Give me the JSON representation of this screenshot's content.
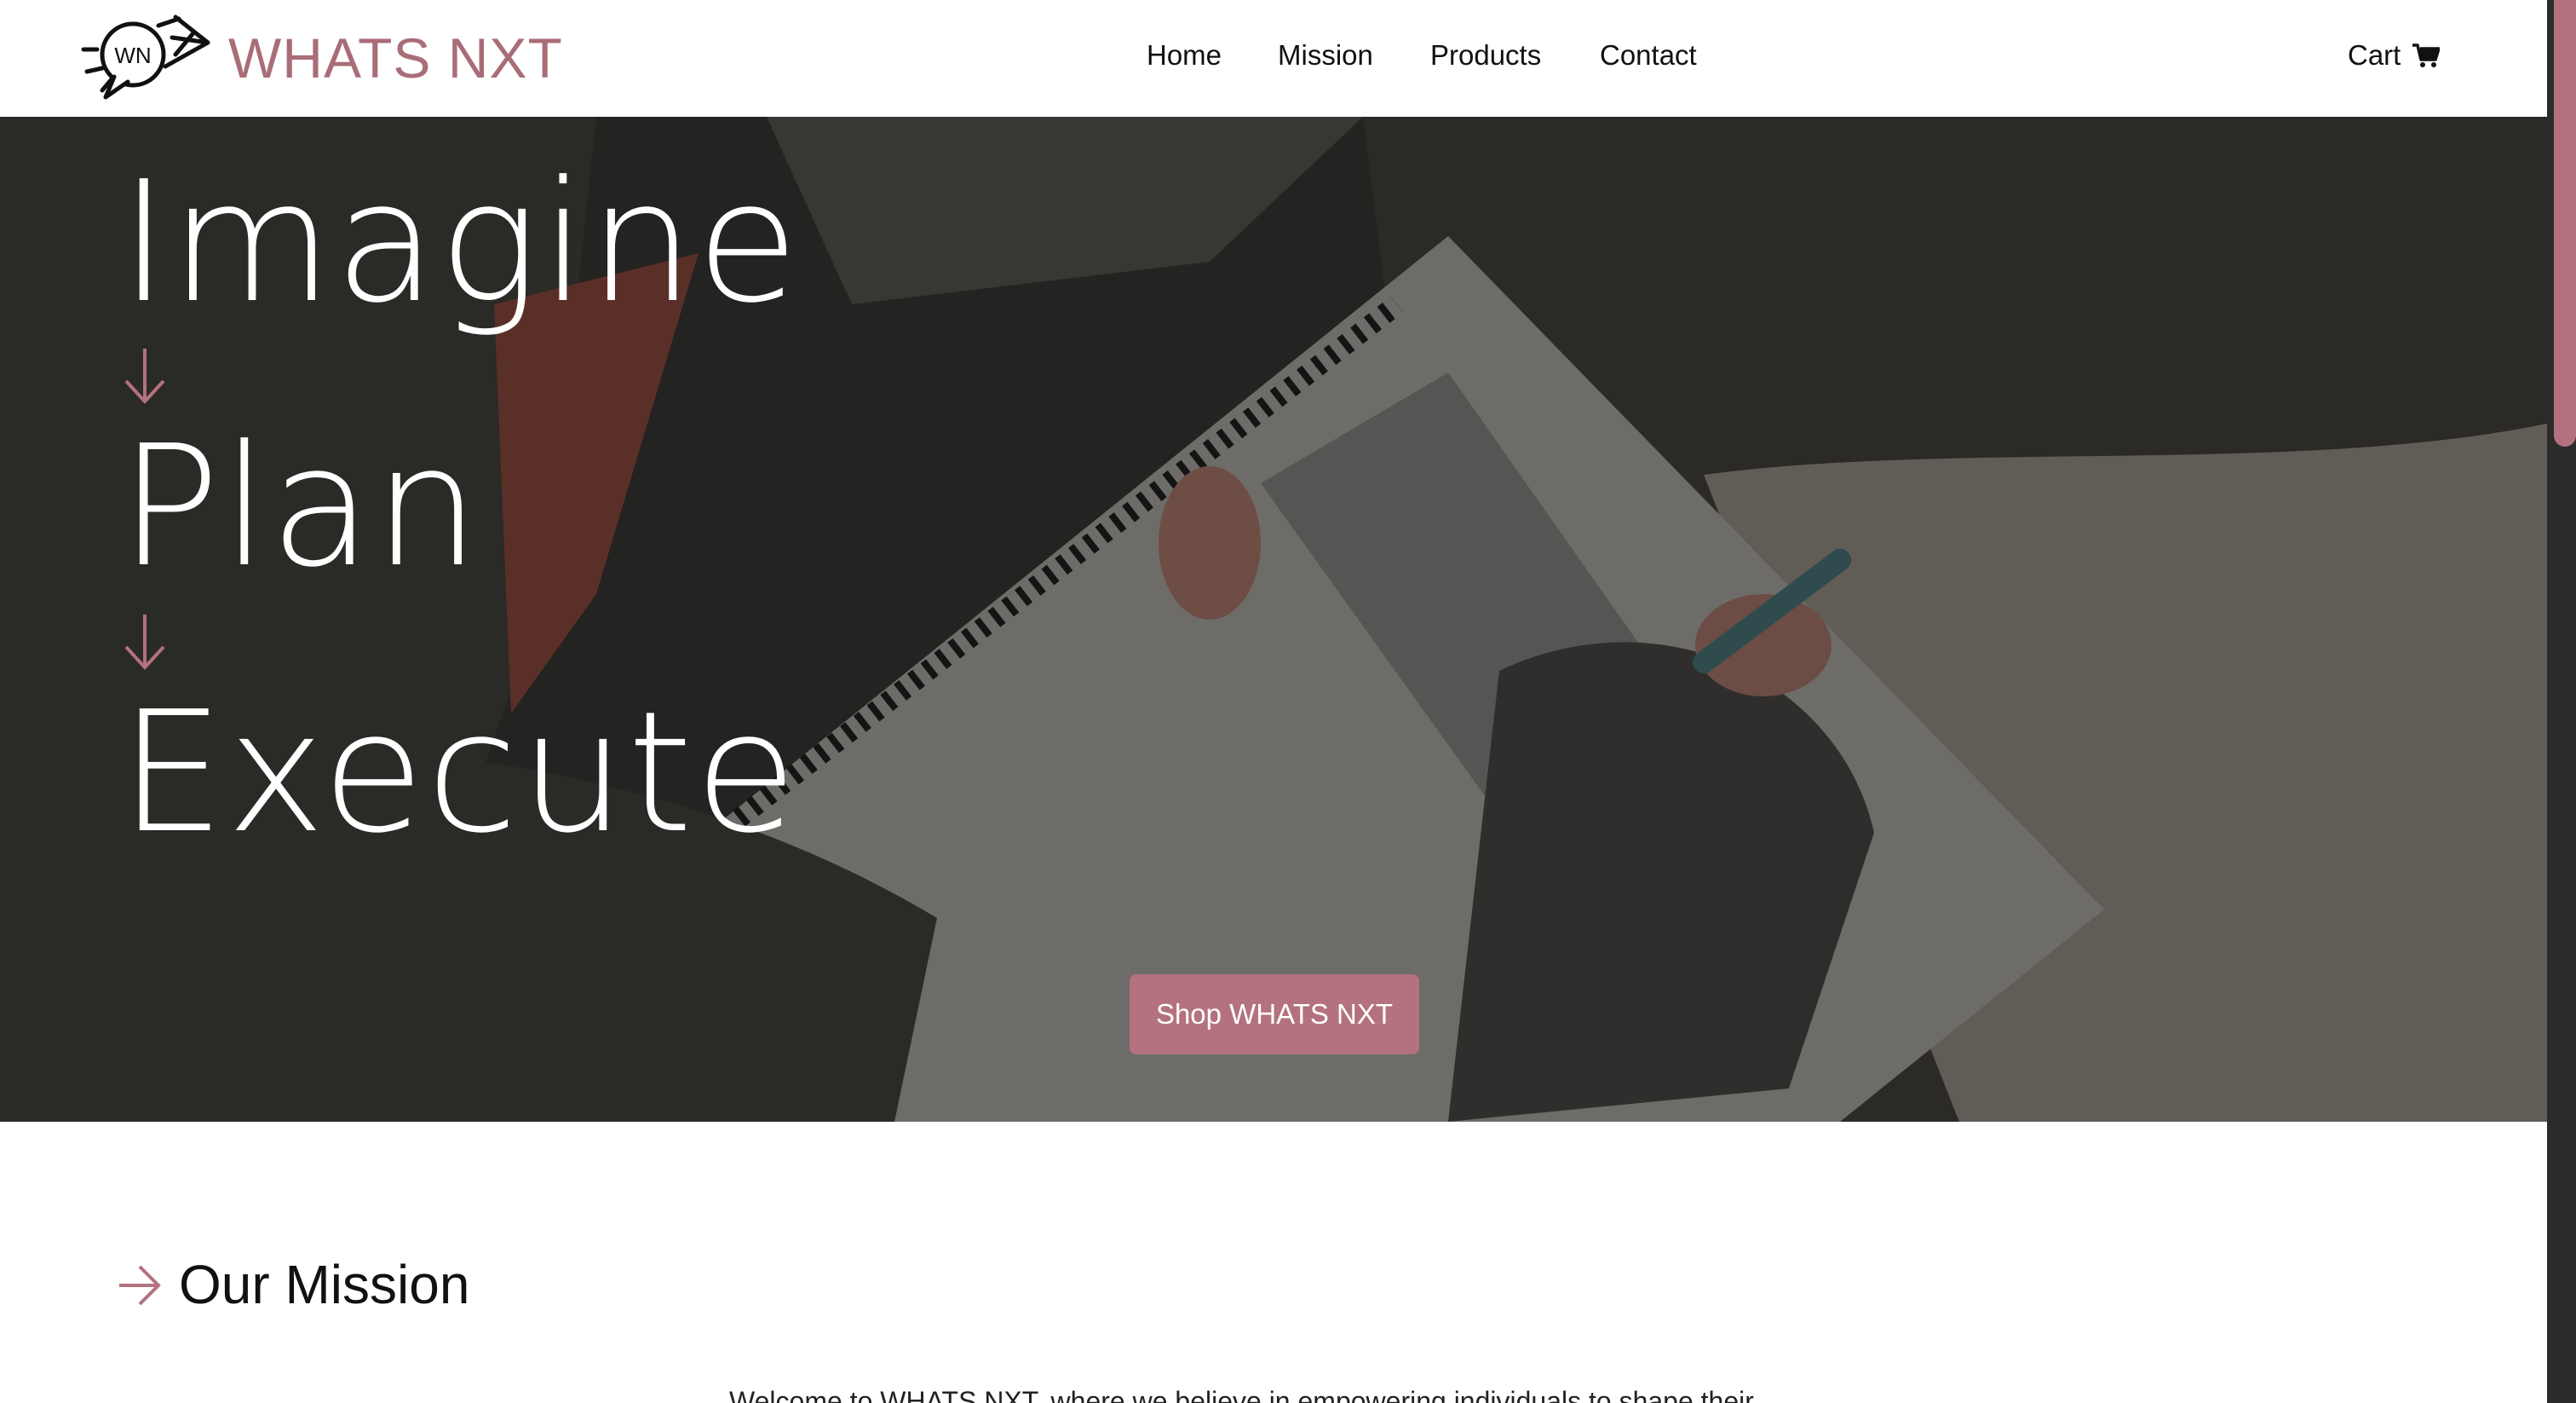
{
  "brand": {
    "logo_text": "WN",
    "name": "WHATS NXT"
  },
  "nav": {
    "items": [
      "Home",
      "Mission",
      "Products",
      "Contact"
    ]
  },
  "cart": {
    "label": "Cart",
    "icon": "shopping-cart-icon"
  },
  "hero": {
    "words": [
      "Imagine",
      "Plan",
      "Execute"
    ],
    "cta_label": "Shop WHATS NXT"
  },
  "mission": {
    "title": "Our Mission",
    "intro_visible_fragment": "Welcome to WHATS NXT, where we believe in empowering individuals to shape their"
  },
  "colors": {
    "accent": "#b3727d",
    "brand_text": "#a96d78",
    "hero_overlay": "#1c1c1a"
  }
}
